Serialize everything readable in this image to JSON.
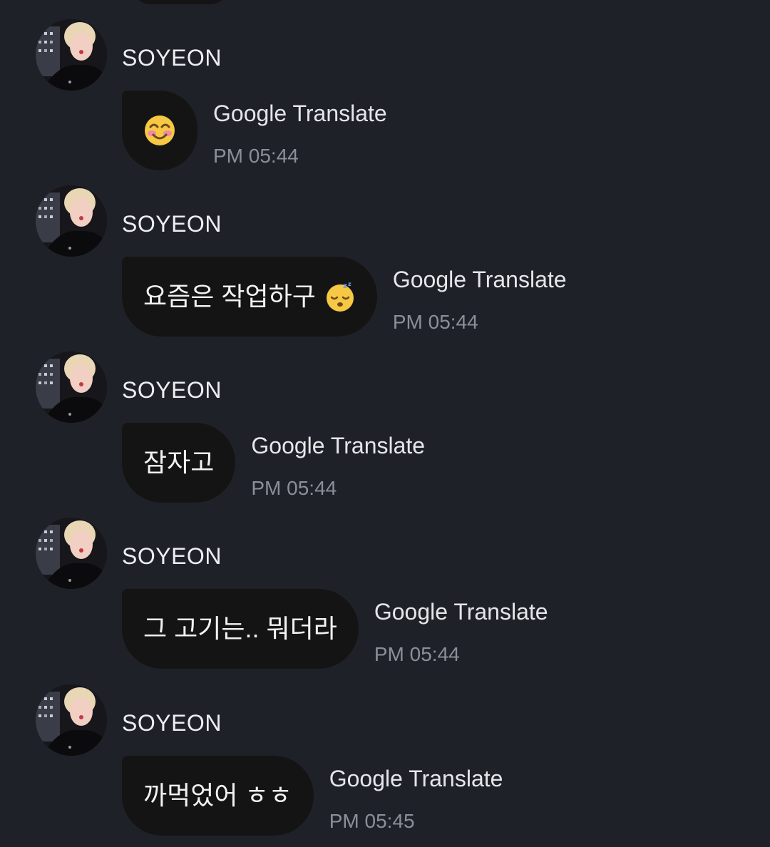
{
  "messages": [
    {
      "sender": "SOYEON",
      "text": "",
      "emoji": "smiling-face-with-smiling-eyes-icon",
      "translate_label": "Google Translate",
      "time": "PM 05:44"
    },
    {
      "sender": "SOYEON",
      "text": "요즘은 작업하구",
      "emoji": "sleeping-face-icon",
      "translate_label": "Google Translate",
      "time": "PM 05:44"
    },
    {
      "sender": "SOYEON",
      "text": "잠자고",
      "emoji": "",
      "translate_label": "Google Translate",
      "time": "PM 05:44"
    },
    {
      "sender": "SOYEON",
      "text": "그 고기는.. 뭐더라",
      "emoji": "",
      "translate_label": "Google Translate",
      "time": "PM 05:44"
    },
    {
      "sender": "SOYEON",
      "text": "까먹었어 ㅎㅎ",
      "emoji": "",
      "translate_label": "Google Translate",
      "time": "PM 05:45"
    }
  ],
  "colors": {
    "background": "#1f2128",
    "bubble": "#141414",
    "text": "#f2f2f4",
    "timestamp": "#8c8f99"
  }
}
